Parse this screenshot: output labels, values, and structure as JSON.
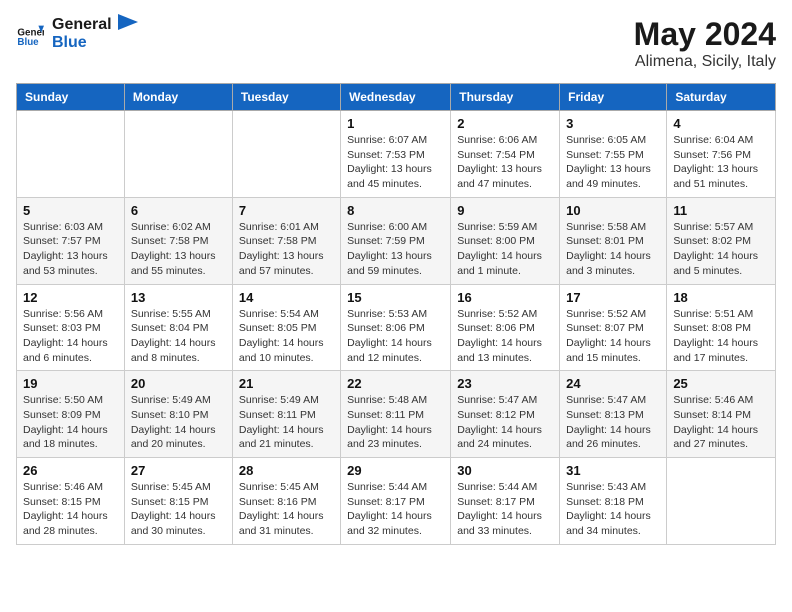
{
  "logo": {
    "line1": "General",
    "line2": "Blue"
  },
  "title": "May 2024",
  "location": "Alimena, Sicily, Italy",
  "days_of_week": [
    "Sunday",
    "Monday",
    "Tuesday",
    "Wednesday",
    "Thursday",
    "Friday",
    "Saturday"
  ],
  "weeks": [
    [
      {
        "day": "",
        "info": ""
      },
      {
        "day": "",
        "info": ""
      },
      {
        "day": "",
        "info": ""
      },
      {
        "day": "1",
        "info": "Sunrise: 6:07 AM\nSunset: 7:53 PM\nDaylight: 13 hours and 45 minutes."
      },
      {
        "day": "2",
        "info": "Sunrise: 6:06 AM\nSunset: 7:54 PM\nDaylight: 13 hours and 47 minutes."
      },
      {
        "day": "3",
        "info": "Sunrise: 6:05 AM\nSunset: 7:55 PM\nDaylight: 13 hours and 49 minutes."
      },
      {
        "day": "4",
        "info": "Sunrise: 6:04 AM\nSunset: 7:56 PM\nDaylight: 13 hours and 51 minutes."
      }
    ],
    [
      {
        "day": "5",
        "info": "Sunrise: 6:03 AM\nSunset: 7:57 PM\nDaylight: 13 hours and 53 minutes."
      },
      {
        "day": "6",
        "info": "Sunrise: 6:02 AM\nSunset: 7:58 PM\nDaylight: 13 hours and 55 minutes."
      },
      {
        "day": "7",
        "info": "Sunrise: 6:01 AM\nSunset: 7:58 PM\nDaylight: 13 hours and 57 minutes."
      },
      {
        "day": "8",
        "info": "Sunrise: 6:00 AM\nSunset: 7:59 PM\nDaylight: 13 hours and 59 minutes."
      },
      {
        "day": "9",
        "info": "Sunrise: 5:59 AM\nSunset: 8:00 PM\nDaylight: 14 hours and 1 minute."
      },
      {
        "day": "10",
        "info": "Sunrise: 5:58 AM\nSunset: 8:01 PM\nDaylight: 14 hours and 3 minutes."
      },
      {
        "day": "11",
        "info": "Sunrise: 5:57 AM\nSunset: 8:02 PM\nDaylight: 14 hours and 5 minutes."
      }
    ],
    [
      {
        "day": "12",
        "info": "Sunrise: 5:56 AM\nSunset: 8:03 PM\nDaylight: 14 hours and 6 minutes."
      },
      {
        "day": "13",
        "info": "Sunrise: 5:55 AM\nSunset: 8:04 PM\nDaylight: 14 hours and 8 minutes."
      },
      {
        "day": "14",
        "info": "Sunrise: 5:54 AM\nSunset: 8:05 PM\nDaylight: 14 hours and 10 minutes."
      },
      {
        "day": "15",
        "info": "Sunrise: 5:53 AM\nSunset: 8:06 PM\nDaylight: 14 hours and 12 minutes."
      },
      {
        "day": "16",
        "info": "Sunrise: 5:52 AM\nSunset: 8:06 PM\nDaylight: 14 hours and 13 minutes."
      },
      {
        "day": "17",
        "info": "Sunrise: 5:52 AM\nSunset: 8:07 PM\nDaylight: 14 hours and 15 minutes."
      },
      {
        "day": "18",
        "info": "Sunrise: 5:51 AM\nSunset: 8:08 PM\nDaylight: 14 hours and 17 minutes."
      }
    ],
    [
      {
        "day": "19",
        "info": "Sunrise: 5:50 AM\nSunset: 8:09 PM\nDaylight: 14 hours and 18 minutes."
      },
      {
        "day": "20",
        "info": "Sunrise: 5:49 AM\nSunset: 8:10 PM\nDaylight: 14 hours and 20 minutes."
      },
      {
        "day": "21",
        "info": "Sunrise: 5:49 AM\nSunset: 8:11 PM\nDaylight: 14 hours and 21 minutes."
      },
      {
        "day": "22",
        "info": "Sunrise: 5:48 AM\nSunset: 8:11 PM\nDaylight: 14 hours and 23 minutes."
      },
      {
        "day": "23",
        "info": "Sunrise: 5:47 AM\nSunset: 8:12 PM\nDaylight: 14 hours and 24 minutes."
      },
      {
        "day": "24",
        "info": "Sunrise: 5:47 AM\nSunset: 8:13 PM\nDaylight: 14 hours and 26 minutes."
      },
      {
        "day": "25",
        "info": "Sunrise: 5:46 AM\nSunset: 8:14 PM\nDaylight: 14 hours and 27 minutes."
      }
    ],
    [
      {
        "day": "26",
        "info": "Sunrise: 5:46 AM\nSunset: 8:15 PM\nDaylight: 14 hours and 28 minutes."
      },
      {
        "day": "27",
        "info": "Sunrise: 5:45 AM\nSunset: 8:15 PM\nDaylight: 14 hours and 30 minutes."
      },
      {
        "day": "28",
        "info": "Sunrise: 5:45 AM\nSunset: 8:16 PM\nDaylight: 14 hours and 31 minutes."
      },
      {
        "day": "29",
        "info": "Sunrise: 5:44 AM\nSunset: 8:17 PM\nDaylight: 14 hours and 32 minutes."
      },
      {
        "day": "30",
        "info": "Sunrise: 5:44 AM\nSunset: 8:17 PM\nDaylight: 14 hours and 33 minutes."
      },
      {
        "day": "31",
        "info": "Sunrise: 5:43 AM\nSunset: 8:18 PM\nDaylight: 14 hours and 34 minutes."
      },
      {
        "day": "",
        "info": ""
      }
    ]
  ]
}
